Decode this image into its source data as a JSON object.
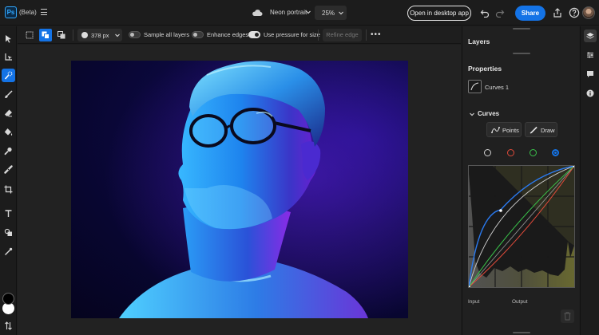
{
  "app": {
    "logo_text": "Ps",
    "beta_label": "(Beta)",
    "document_name": "Neon portrait",
    "zoom_value": "25%",
    "open_desktop_label": "Open in desktop app",
    "share_label": "Share"
  },
  "options_bar": {
    "brush_size": "378 px",
    "sample_all_layers": {
      "label": "Sample all layers",
      "on": false
    },
    "enhance_edges": {
      "label": "Enhance edges",
      "on": false
    },
    "use_pressure": {
      "label": "Use pressure for size",
      "on": true
    },
    "refine_edge_label": "Refine edge",
    "more_label": "•••"
  },
  "left_tools": [
    "move-tool-icon",
    "transform-tool-icon",
    "quick-selection-tool-icon",
    "brush-tool-icon",
    "eraser-tool-icon",
    "paint-bucket-tool-icon",
    "clone-stamp-tool-icon",
    "healing-brush-tool-icon",
    "crop-tool-icon",
    "type-tool-icon",
    "shape-tool-icon",
    "eyedropper-tool-icon"
  ],
  "colors": {
    "accent": "#1473e6",
    "foreground": "#000000",
    "background": "#ffffff"
  },
  "panel": {
    "layers_title": "Layers",
    "properties_title": "Properties",
    "adjustment_name": "Curves 1",
    "curves_section_title": "Curves",
    "points_label": "Points",
    "draw_label": "Draw",
    "channels": [
      "rgb",
      "red",
      "green",
      "blue"
    ],
    "selected_channel": "blue",
    "input_label": "Input",
    "output_label": "Output"
  }
}
